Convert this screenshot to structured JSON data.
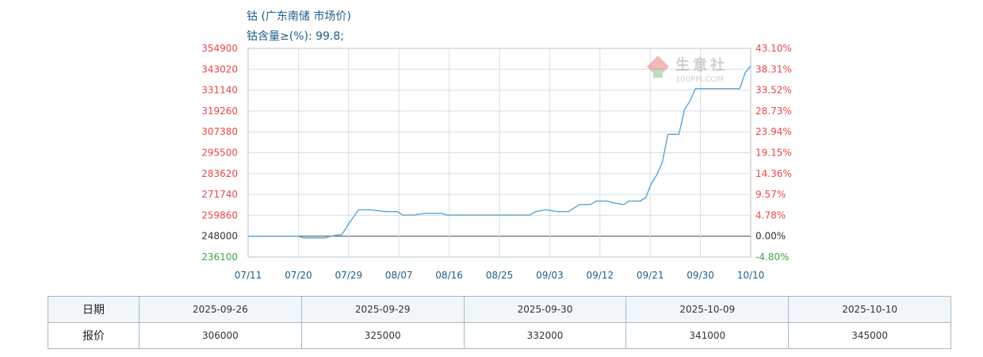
{
  "header": {
    "title": "钴 (广东南储 市场价)",
    "subtitle": "钴含量≥(%): 99.8;"
  },
  "watermark": {
    "name": "生意社",
    "site": "100PPI.COM"
  },
  "colors": {
    "line": "#5aa3d8",
    "left_axis": "#e8474a",
    "pos_pct": "#e8474a",
    "neg": "#3ea640",
    "zero": "#333333",
    "date": "#1f5e8a"
  },
  "chart_data": {
    "type": "line",
    "x_ticks": [
      "07/11",
      "07/20",
      "07/29",
      "08/07",
      "08/16",
      "08/25",
      "09/03",
      "09/12",
      "09/21",
      "09/30",
      "10/10"
    ],
    "y_ticks": [
      "236100",
      "248000",
      "259860",
      "271740",
      "283620",
      "295500",
      "307380",
      "319260",
      "331140",
      "343020",
      "354900"
    ],
    "y_pct_ticks": [
      "-4.80%",
      "0.00%",
      "4.78%",
      "9.57%",
      "14.36%",
      "19.15%",
      "23.94%",
      "28.73%",
      "33.52%",
      "38.31%",
      "43.10%"
    ],
    "ylim": [
      236100,
      354900
    ],
    "xlim": [
      "2025-07-11",
      "2025-10-10"
    ],
    "grid": true,
    "series": [
      {
        "points": [
          [
            "2025-07-11",
            248000
          ],
          [
            "2025-07-20",
            248000
          ],
          [
            "2025-07-21",
            247000
          ],
          [
            "2025-07-25",
            247000
          ],
          [
            "2025-07-26",
            248000
          ],
          [
            "2025-07-28",
            249000
          ],
          [
            "2025-07-29",
            254000
          ],
          [
            "2025-07-31",
            263000
          ],
          [
            "2025-08-02",
            263000
          ],
          [
            "2025-08-05",
            262000
          ],
          [
            "2025-08-07",
            262000
          ],
          [
            "2025-08-08",
            260000
          ],
          [
            "2025-08-10",
            260000
          ],
          [
            "2025-08-12",
            261000
          ],
          [
            "2025-08-15",
            261000
          ],
          [
            "2025-08-16",
            260000
          ],
          [
            "2025-08-31",
            260000
          ],
          [
            "2025-09-01",
            262000
          ],
          [
            "2025-09-03",
            263000
          ],
          [
            "2025-09-05",
            262000
          ],
          [
            "2025-09-07",
            262000
          ],
          [
            "2025-09-09",
            266000
          ],
          [
            "2025-09-11",
            266000
          ],
          [
            "2025-09-12",
            268000
          ],
          [
            "2025-09-14",
            268000
          ],
          [
            "2025-09-15",
            267000
          ],
          [
            "2025-09-17",
            266000
          ],
          [
            "2025-09-18",
            268000
          ],
          [
            "2025-09-20",
            268000
          ],
          [
            "2025-09-21",
            270000
          ],
          [
            "2025-09-22",
            278000
          ],
          [
            "2025-09-23",
            283000
          ],
          [
            "2025-09-24",
            290000
          ],
          [
            "2025-09-25",
            306000
          ],
          [
            "2025-09-26",
            306000
          ],
          [
            "2025-09-27",
            306000
          ],
          [
            "2025-09-28",
            320000
          ],
          [
            "2025-09-29",
            325000
          ],
          [
            "2025-09-30",
            332000
          ],
          [
            "2025-10-08",
            332000
          ],
          [
            "2025-10-09",
            341000
          ],
          [
            "2025-10-10",
            345000
          ]
        ]
      }
    ]
  },
  "table": {
    "row_labels": [
      "日期",
      "报价"
    ],
    "dates": [
      "2025-09-26",
      "2025-09-29",
      "2025-09-30",
      "2025-10-09",
      "2025-10-10"
    ],
    "prices": [
      "306000",
      "325000",
      "332000",
      "341000",
      "345000"
    ]
  }
}
